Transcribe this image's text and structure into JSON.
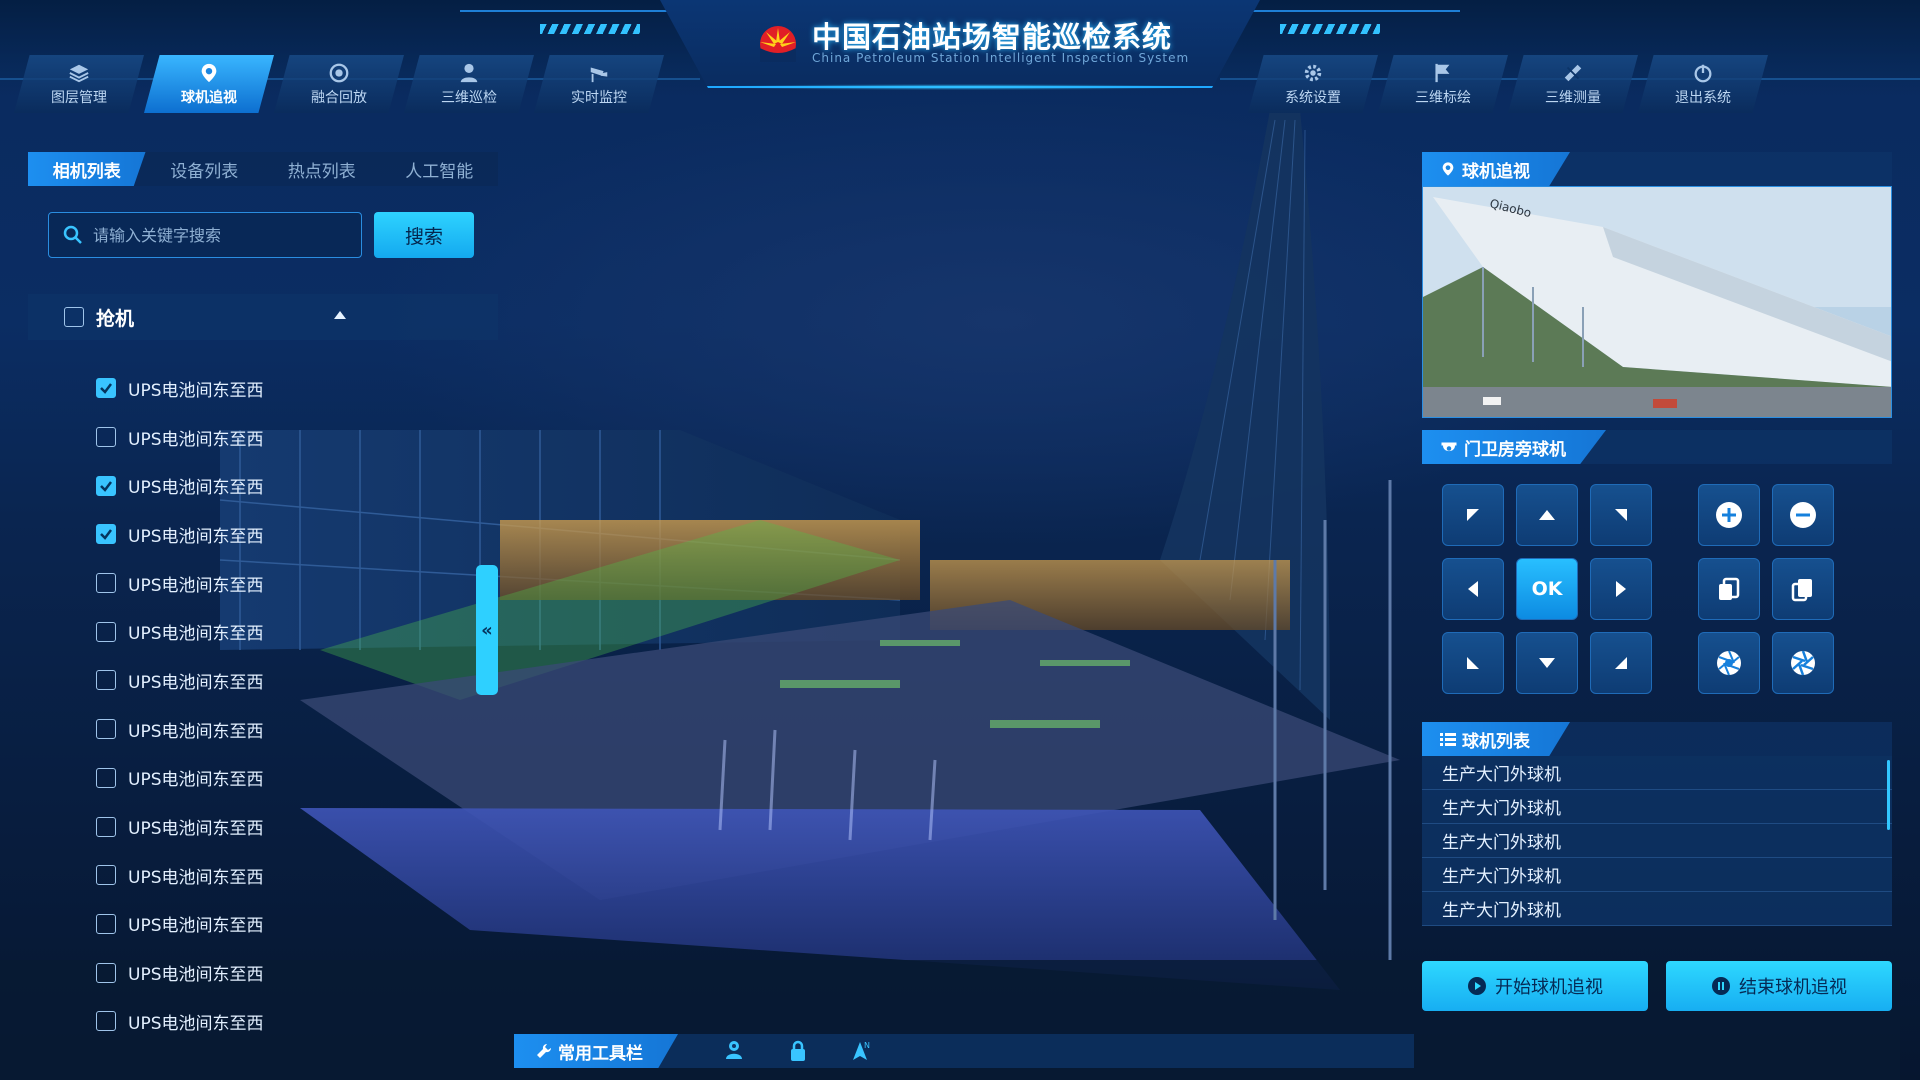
{
  "header": {
    "title": "中国石油站场智能巡检系统",
    "subtitle": "China Petroleum Station Intelligent Inspection System"
  },
  "nav_left": [
    {
      "label": "图层管理",
      "icon": "layers-icon",
      "active": false
    },
    {
      "label": "球机追视",
      "icon": "location-pin-icon",
      "active": true
    },
    {
      "label": "融合回放",
      "icon": "replay-icon",
      "active": false
    },
    {
      "label": "三维巡检",
      "icon": "inspector-icon",
      "active": false
    },
    {
      "label": "实时监控",
      "icon": "cctv-camera-icon",
      "active": false
    }
  ],
  "nav_right": [
    {
      "label": "系统设置",
      "icon": "gear-icon"
    },
    {
      "label": "三维标绘",
      "icon": "flag-icon"
    },
    {
      "label": "三维测量",
      "icon": "ruler-icon"
    },
    {
      "label": "退出系统",
      "icon": "power-icon"
    }
  ],
  "left_panel": {
    "tabs": [
      {
        "label": "相机列表",
        "active": true
      },
      {
        "label": "设备列表",
        "active": false
      },
      {
        "label": "热点列表",
        "active": false
      },
      {
        "label": "人工智能",
        "active": false
      }
    ],
    "search": {
      "placeholder": "请输入关键字搜索",
      "button": "搜索"
    },
    "group": {
      "label": "抢机",
      "checked": false,
      "expanded": true
    },
    "items": [
      {
        "label": "UPS电池间东至西",
        "checked": true
      },
      {
        "label": "UPS电池间东至西",
        "checked": false
      },
      {
        "label": "UPS电池间东至西",
        "checked": true
      },
      {
        "label": "UPS电池间东至西",
        "checked": true
      },
      {
        "label": "UPS电池间东至西",
        "checked": false
      },
      {
        "label": "UPS电池间东至西",
        "checked": false
      },
      {
        "label": "UPS电池间东至西",
        "checked": false
      },
      {
        "label": "UPS电池间东至西",
        "checked": false
      },
      {
        "label": "UPS电池间东至西",
        "checked": false
      },
      {
        "label": "UPS电池间东至西",
        "checked": false
      },
      {
        "label": "UPS电池间东至西",
        "checked": false
      },
      {
        "label": "UPS电池间东至西",
        "checked": false
      },
      {
        "label": "UPS电池间东至西",
        "checked": false
      },
      {
        "label": "UPS电池间东至西",
        "checked": false
      }
    ]
  },
  "right_panel": {
    "preview_title": "球机追视",
    "preview_sign": "Qiaobo",
    "ptz_title": "门卫房旁球机",
    "ptz_ok": "OK",
    "list_title": "球机列表",
    "cameras": [
      "生产大门外球机",
      "生产大门外球机",
      "生产大门外球机",
      "生产大门外球机",
      "生产大门外球机"
    ],
    "start_button": "开始球机追视",
    "stop_button": "结束球机追视"
  },
  "toolbar": {
    "title": "常用工具栏",
    "tools": [
      "user-location-icon",
      "lock-icon",
      "compass-north-icon"
    ]
  },
  "colors": {
    "accent": "#2ed0ff",
    "primary": "#1d8ff0",
    "panel": "#0e3468",
    "background": "#041a35"
  }
}
